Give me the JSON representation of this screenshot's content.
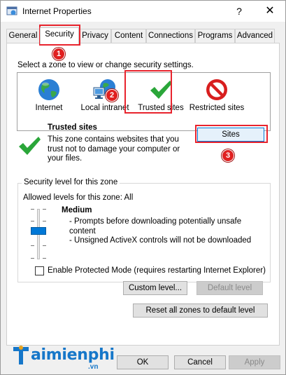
{
  "window": {
    "title": "Internet Properties",
    "help_glyph": "?",
    "close_glyph": "✕"
  },
  "tabs": [
    {
      "label": "General"
    },
    {
      "label": "Security"
    },
    {
      "label": "Privacy"
    },
    {
      "label": "Content"
    },
    {
      "label": "Connections"
    },
    {
      "label": "Programs"
    },
    {
      "label": "Advanced"
    }
  ],
  "security": {
    "instruction": "Select a zone to view or change security settings.",
    "zones": [
      {
        "label": "Internet",
        "icon": "globe-icon"
      },
      {
        "label": "Local intranet",
        "icon": "local-intranet-icon"
      },
      {
        "label": "Trusted sites",
        "icon": "green-check-icon",
        "selected": true
      },
      {
        "label": "Restricted sites",
        "icon": "restricted-icon"
      }
    ],
    "selected_zone": {
      "title": "Trusted sites",
      "description": "This zone contains websites that you trust not to damage your computer or your files.",
      "sites_button": "Sites"
    },
    "level_group": {
      "label": "Security level for this zone",
      "allowed": "Allowed levels for this zone: All",
      "level_name": "Medium",
      "level_lines": [
        "- Prompts before downloading potentially unsafe content",
        "- Unsigned ActiveX controls will not be downloaded"
      ],
      "slider_level": "Medium"
    },
    "protected_mode": {
      "label": "Enable Protected Mode (requires restarting Internet Explorer)",
      "checked": false
    },
    "custom_level_button": "Custom level...",
    "default_level_button": "Default level",
    "reset_all_button": "Reset all zones to default level"
  },
  "footer": {
    "ok": "OK",
    "cancel": "Cancel",
    "apply": "Apply"
  },
  "annotations": {
    "marker_1": "1",
    "marker_2": "2",
    "marker_3": "3"
  },
  "watermark": {
    "brand": "aimienphi",
    "domain": ".vn"
  },
  "colors": {
    "accent": "#0078d7",
    "marker_red": "#e02020",
    "brand_blue": "#1677c9"
  }
}
